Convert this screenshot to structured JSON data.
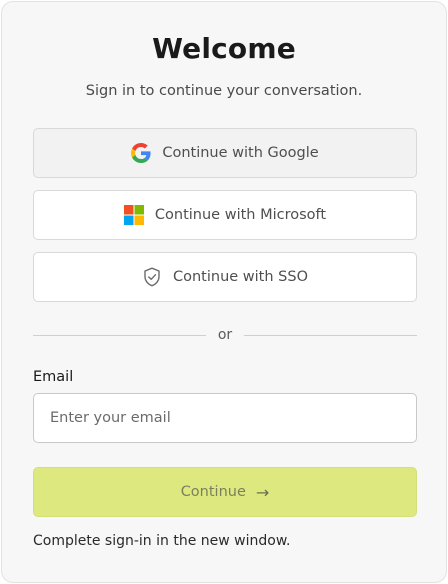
{
  "header": {
    "title": "Welcome",
    "subtitle": "Sign in to continue your conversation."
  },
  "providers": [
    {
      "label": "Continue with Google",
      "icon": "google-icon"
    },
    {
      "label": "Continue with Microsoft",
      "icon": "microsoft-icon"
    },
    {
      "label": "Continue with SSO",
      "icon": "shield-check-icon"
    }
  ],
  "divider": {
    "text": "or"
  },
  "email": {
    "label": "Email",
    "value": "",
    "placeholder": "Enter your email"
  },
  "continue": {
    "label": "Continue",
    "arrow": "→"
  },
  "note": "Complete sign-in in the new window.",
  "colors": {
    "card_bg": "#f7f7f7",
    "continue_bg": "#dde97f",
    "google_blue": "#4285F4",
    "google_red": "#EA4335",
    "google_yellow": "#FBBC05",
    "google_green": "#34A853",
    "ms_red": "#F25022",
    "ms_green": "#7FBA00",
    "ms_blue": "#00A4EF",
    "ms_yellow": "#FFB900"
  }
}
